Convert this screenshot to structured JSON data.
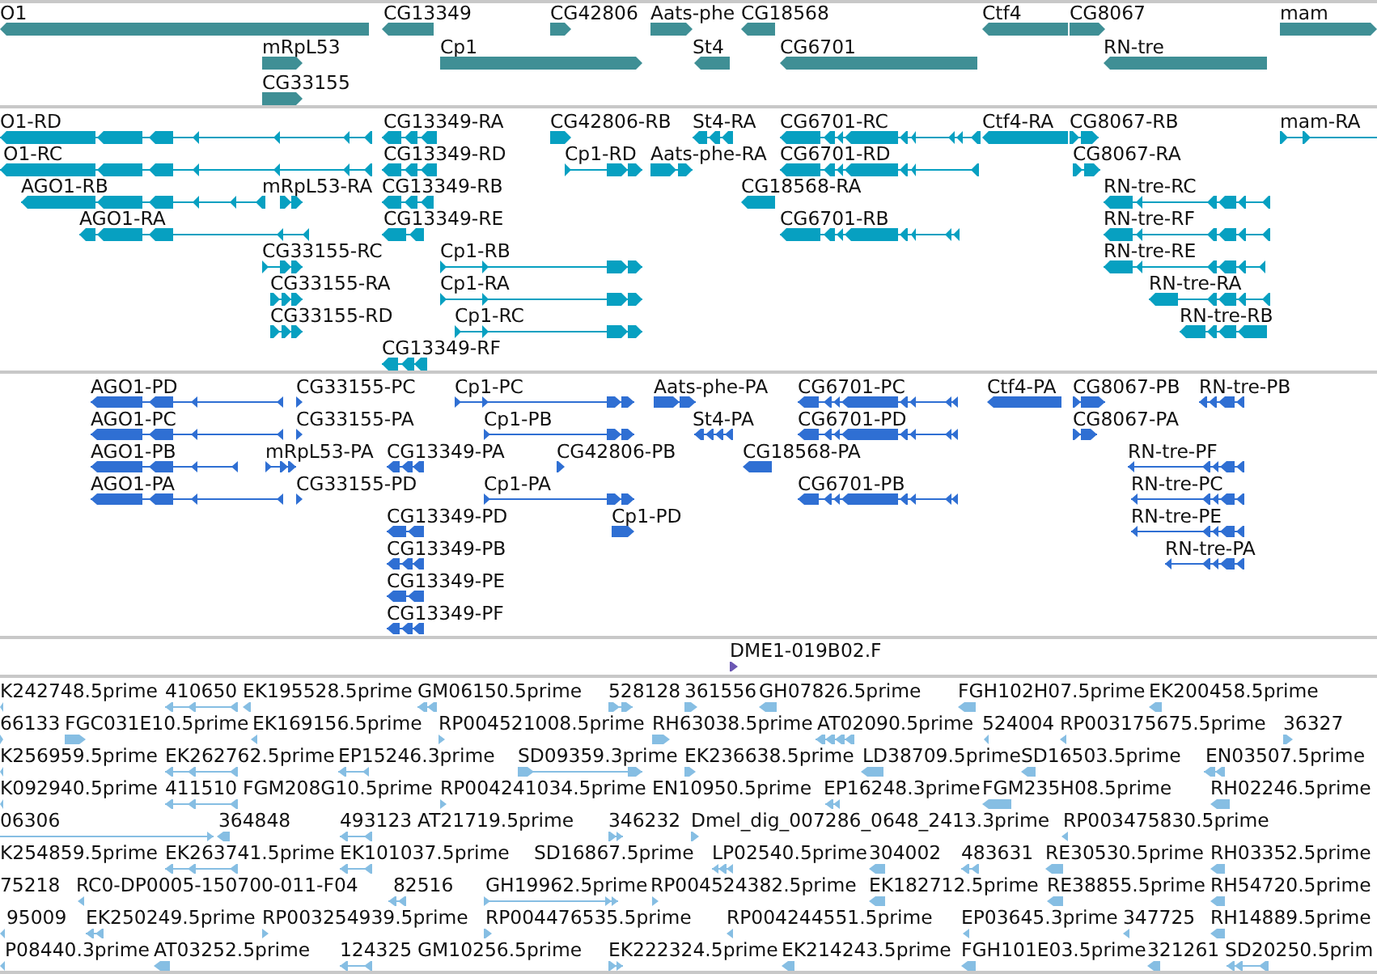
{
  "tracks": [
    {
      "kind": "gene",
      "features": [
        {
          "label": "O1",
          "reverse": true
        },
        {
          "label": "CG13349",
          "reverse": true
        },
        {
          "label": "CG42806",
          "reverse": false
        },
        {
          "label": "Aats-phe",
          "reverse": false
        },
        {
          "label": "CG18568",
          "reverse": true
        },
        {
          "label": "Ctf4",
          "reverse": true
        },
        {
          "label": "CG8067",
          "reverse": false
        },
        {
          "label": "mam",
          "reverse": false
        },
        {
          "label": "mRpL53",
          "reverse": false
        },
        {
          "label": "Cp1",
          "reverse": false
        },
        {
          "label": "St4",
          "reverse": true
        },
        {
          "label": "CG6701",
          "reverse": true
        },
        {
          "label": "RN-tre",
          "reverse": true
        },
        {
          "label": "CG33155",
          "reverse": false
        }
      ]
    },
    {
      "kind": "transcript",
      "features": [
        {
          "label": "O1-RD",
          "reverse": true
        },
        {
          "label": "CG13349-RA",
          "reverse": true
        },
        {
          "label": "CG42806-RB",
          "reverse": false
        },
        {
          "label": "St4-RA",
          "reverse": true
        },
        {
          "label": "CG6701-RC",
          "reverse": true
        },
        {
          "label": "Ctf4-RA",
          "reverse": true
        },
        {
          "label": "CG8067-RB",
          "reverse": false
        },
        {
          "label": "mam-RA",
          "reverse": false
        },
        {
          "label": "O1-RC",
          "reverse": true
        },
        {
          "label": "CG13349-RD",
          "reverse": true
        },
        {
          "label": "Cp1-RD",
          "reverse": false
        },
        {
          "label": "Aats-phe-RA",
          "reverse": false
        },
        {
          "label": "CG6701-RD",
          "reverse": true
        },
        {
          "label": "CG8067-RA",
          "reverse": false
        },
        {
          "label": "AGO1-RB",
          "reverse": true
        },
        {
          "label": "mRpL53-RA",
          "reverse": false
        },
        {
          "label": "CG13349-RB",
          "reverse": true
        },
        {
          "label": "CG18568-RA",
          "reverse": true
        },
        {
          "label": "RN-tre-RC",
          "reverse": true
        },
        {
          "label": "AGO1-RA",
          "reverse": true
        },
        {
          "label": "CG13349-RE",
          "reverse": true
        },
        {
          "label": "CG6701-RB",
          "reverse": true
        },
        {
          "label": "RN-tre-RF",
          "reverse": true
        },
        {
          "label": "CG33155-RC",
          "reverse": false
        },
        {
          "label": "Cp1-RB",
          "reverse": false
        },
        {
          "label": "RN-tre-RE",
          "reverse": true
        },
        {
          "label": "CG33155-RA",
          "reverse": false
        },
        {
          "label": "Cp1-RA",
          "reverse": false
        },
        {
          "label": "RN-tre-RA",
          "reverse": true
        },
        {
          "label": "CG33155-RD",
          "reverse": false
        },
        {
          "label": "Cp1-RC",
          "reverse": false
        },
        {
          "label": "RN-tre-RB",
          "reverse": true
        },
        {
          "label": "CG13349-RF",
          "reverse": true
        }
      ]
    },
    {
      "kind": "protein",
      "features": [
        {
          "label": "AGO1-PD",
          "reverse": true
        },
        {
          "label": "CG33155-PC",
          "reverse": false
        },
        {
          "label": "Cp1-PC",
          "reverse": false
        },
        {
          "label": "Aats-phe-PA",
          "reverse": false
        },
        {
          "label": "CG6701-PC",
          "reverse": true
        },
        {
          "label": "Ctf4-PA",
          "reverse": true
        },
        {
          "label": "CG8067-PB",
          "reverse": false
        },
        {
          "label": "RN-tre-PB",
          "reverse": true
        },
        {
          "label": "AGO1-PC",
          "reverse": true
        },
        {
          "label": "CG33155-PA",
          "reverse": false
        },
        {
          "label": "Cp1-PB",
          "reverse": false
        },
        {
          "label": "St4-PA",
          "reverse": true
        },
        {
          "label": "CG6701-PD",
          "reverse": true
        },
        {
          "label": "CG8067-PA",
          "reverse": false
        },
        {
          "label": "AGO1-PB",
          "reverse": true
        },
        {
          "label": "mRpL53-PA",
          "reverse": false
        },
        {
          "label": "CG13349-PA",
          "reverse": true
        },
        {
          "label": "CG42806-PB",
          "reverse": false
        },
        {
          "label": "CG18568-PA",
          "reverse": true
        },
        {
          "label": "RN-tre-PF",
          "reverse": true
        },
        {
          "label": "AGO1-PA",
          "reverse": true
        },
        {
          "label": "CG33155-PD",
          "reverse": false
        },
        {
          "label": "Cp1-PA",
          "reverse": false
        },
        {
          "label": "CG6701-PB",
          "reverse": true
        },
        {
          "label": "RN-tre-PC",
          "reverse": true
        },
        {
          "label": "CG13349-PD",
          "reverse": true
        },
        {
          "label": "Cp1-PD",
          "reverse": false
        },
        {
          "label": "RN-tre-PE",
          "reverse": true
        },
        {
          "label": "CG13349-PB",
          "reverse": true
        },
        {
          "label": "RN-tre-PA",
          "reverse": true
        },
        {
          "label": "CG13349-PE",
          "reverse": true
        },
        {
          "label": "CG13349-PF",
          "reverse": true
        }
      ]
    },
    {
      "kind": "clone_end",
      "features": [
        {
          "label": "DME1-019B02.F",
          "reverse": false
        }
      ]
    },
    {
      "kind": "est",
      "features": [
        {
          "label": "K242748.5prime",
          "reverse": true
        },
        {
          "label": "410650",
          "reverse": true
        },
        {
          "label": "EK195528.5prime",
          "reverse": true
        },
        {
          "label": "GM06150.5prime",
          "reverse": true
        },
        {
          "label": "528128",
          "reverse": false
        },
        {
          "label": "361556",
          "reverse": false
        },
        {
          "label": "GH07826.5prime",
          "reverse": true
        },
        {
          "label": "FGH102H07.5prime",
          "reverse": true
        },
        {
          "label": "EK200458.5prime",
          "reverse": true
        },
        {
          "label": "66133",
          "reverse": false
        },
        {
          "label": "FGC031E10.5prime",
          "reverse": false
        },
        {
          "label": "EK169156.5prime",
          "reverse": true
        },
        {
          "label": "RP004521008.5prime",
          "reverse": false
        },
        {
          "label": "RH63038.5prime",
          "reverse": false
        },
        {
          "label": "AT02090.5prime",
          "reverse": true
        },
        {
          "label": "524004",
          "reverse": true
        },
        {
          "label": "RP003175675.5prime",
          "reverse": true
        },
        {
          "label": "36327",
          "reverse": false
        },
        {
          "label": "K256959.5prime",
          "reverse": true
        },
        {
          "label": "EK262762.5prime",
          "reverse": true
        },
        {
          "label": "EP15246.3prime",
          "reverse": true
        },
        {
          "label": "SD09359.3prime",
          "reverse": false
        },
        {
          "label": "EK236638.5prime",
          "reverse": false
        },
        {
          "label": "LD38709.5prime",
          "reverse": true
        },
        {
          "label": "SD16503.5prime",
          "reverse": true
        },
        {
          "label": "EN03507.5prime",
          "reverse": true
        },
        {
          "label": "K092940.5prime",
          "reverse": true
        },
        {
          "label": "411510",
          "reverse": true
        },
        {
          "label": "FGM208G10.5prime"
        },
        {
          "label": "RP004241034.5prime",
          "reverse": false
        },
        {
          "label": "EN10950.5prime"
        },
        {
          "label": "EP16248.3prime",
          "reverse": true
        },
        {
          "label": "FGM235H08.5prime",
          "reverse": true
        },
        {
          "label": "RH02246.5prime",
          "reverse": true
        },
        {
          "label": "06306",
          "reverse": false
        },
        {
          "label": "364848",
          "reverse": true
        },
        {
          "label": "493123",
          "reverse": true
        },
        {
          "label": "AT21719.5prime"
        },
        {
          "label": "346232",
          "reverse": false
        },
        {
          "label": "Dmel_dig_007286_0648_2413.3prime",
          "reverse": false
        },
        {
          "label": "RP003475830.5prime",
          "reverse": true
        },
        {
          "label": "K254859.5prime"
        },
        {
          "label": "EK263741.5prime",
          "reverse": true
        },
        {
          "label": "EK101037.5prime",
          "reverse": true
        },
        {
          "label": "SD16867.5prime"
        },
        {
          "label": "LP02540.5prime",
          "reverse": true
        },
        {
          "label": "304002",
          "reverse": true
        },
        {
          "label": "483631",
          "reverse": true
        },
        {
          "label": "RE30530.5prime",
          "reverse": true
        },
        {
          "label": "RH03352.5prime",
          "reverse": true
        },
        {
          "label": "75218"
        },
        {
          "label": "RC0-DP0005-150700-011-F04",
          "reverse": true
        },
        {
          "label": "82516",
          "reverse": true
        },
        {
          "label": "GH19962.5prime",
          "reverse": false
        },
        {
          "label": "RP004524382.5prime",
          "reverse": false
        },
        {
          "label": "EK182712.5prime",
          "reverse": true
        },
        {
          "label": "RE38855.5prime",
          "reverse": true
        },
        {
          "label": "RH54720.5prime",
          "reverse": true
        },
        {
          "label": "95009",
          "reverse": true
        },
        {
          "label": "EK250249.5prime",
          "reverse": true
        },
        {
          "label": "RP003254939.5prime",
          "reverse": false
        },
        {
          "label": "RP004476535.5prime",
          "reverse": false
        },
        {
          "label": "RP004244551.5prime",
          "reverse": true
        },
        {
          "label": "EP03645.3prime",
          "reverse": true
        },
        {
          "label": "347725",
          "reverse": true
        },
        {
          "label": "RH14889.5prime",
          "reverse": true
        },
        {
          "label": "P08440.3prime",
          "reverse": true
        },
        {
          "label": "AT03252.5prime",
          "reverse": true
        },
        {
          "label": "124325",
          "reverse": true
        },
        {
          "label": "GM10256.5prime"
        },
        {
          "label": "EK222324.5prime",
          "reverse": false
        },
        {
          "label": "EK214243.5prime",
          "reverse": true
        },
        {
          "label": "FGH101E03.5prime",
          "reverse": true
        },
        {
          "label": "321261",
          "reverse": true
        },
        {
          "label": "SD20250.5prim",
          "reverse": true
        }
      ]
    }
  ]
}
